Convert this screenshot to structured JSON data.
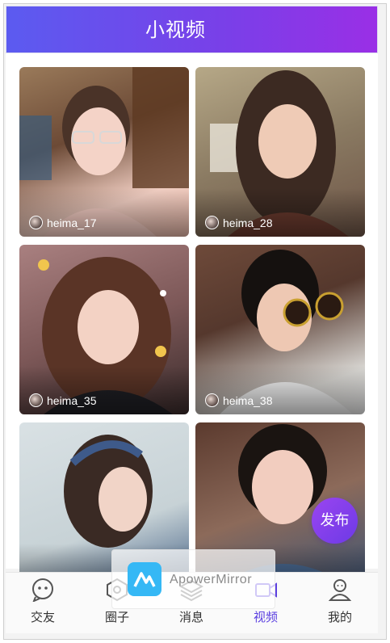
{
  "header": {
    "title": "小视频"
  },
  "videos": [
    {
      "username": "heima_17"
    },
    {
      "username": "heima_28"
    },
    {
      "username": "heima_35"
    },
    {
      "username": "heima_38"
    },
    {
      "username": ""
    },
    {
      "username": ""
    }
  ],
  "fab": {
    "label": "发布"
  },
  "tabbar": {
    "items": [
      {
        "label": "交友",
        "icon": "chat-face-icon"
      },
      {
        "label": "圈子",
        "icon": "hexagon-icon"
      },
      {
        "label": "消息",
        "icon": "layers-icon"
      },
      {
        "label": "视频",
        "icon": "video-camera-icon"
      },
      {
        "label": "我的",
        "icon": "person-icon"
      }
    ],
    "active_index": 3
  },
  "overlay": {
    "app_name": "ApowerMirror"
  },
  "colors": {
    "header_start": "#5b5bf0",
    "header_end": "#9a2fe6",
    "active_tab": "#5b3fe0",
    "fab": "#7d3de9"
  }
}
